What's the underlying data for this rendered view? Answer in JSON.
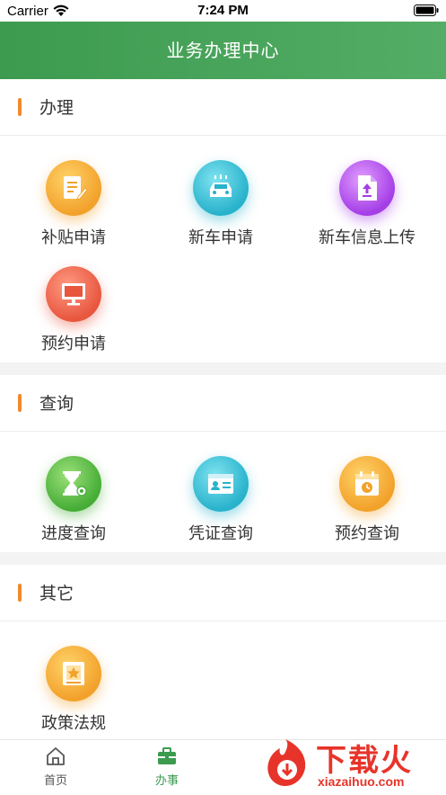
{
  "status_bar": {
    "carrier": "Carrier",
    "time": "7:24 PM"
  },
  "nav": {
    "title": "业务办理中心"
  },
  "sections": [
    {
      "title": "办理",
      "items": [
        {
          "label": "补贴申请",
          "icon": "document-edit-icon",
          "color": "#f2a12a"
        },
        {
          "label": "新车申请",
          "icon": "car-icon",
          "color": "#28b2cc"
        },
        {
          "label": "新车信息上传",
          "icon": "upload-file-icon",
          "color": "#a43ee6"
        },
        {
          "label": "预约申请",
          "icon": "monitor-icon",
          "color": "#e8563e"
        }
      ]
    },
    {
      "title": "查询",
      "items": [
        {
          "label": "进度查询",
          "icon": "hourglass-gear-icon",
          "color": "#45ad36"
        },
        {
          "label": "凭证查询",
          "icon": "id-card-icon",
          "color": "#28b2cc"
        },
        {
          "label": "预约查询",
          "icon": "calendar-clock-icon",
          "color": "#f2a12a"
        }
      ]
    },
    {
      "title": "其它",
      "items": [
        {
          "label": "政策法规",
          "icon": "star-book-icon",
          "color": "#f2a12a"
        }
      ]
    }
  ],
  "tabbar": {
    "tabs": [
      {
        "label": "首页",
        "icon": "home-icon",
        "active": false
      },
      {
        "label": "办事",
        "icon": "briefcase-icon",
        "active": true
      }
    ],
    "active_color": "#3c9b4f",
    "inactive_color": "#555555"
  },
  "watermark": {
    "title": "下载火",
    "url": "xiazaihuo.com"
  }
}
